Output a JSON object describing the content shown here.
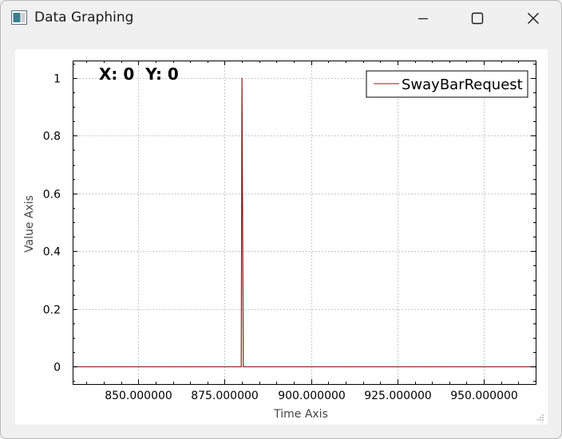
{
  "window": {
    "title": "Data Graphing",
    "icons": {
      "app": "chart-window-icon",
      "minimize": "minimize-icon",
      "maximize": "maximize-icon",
      "close": "close-icon",
      "grip": "resize-grip-icon"
    }
  },
  "readout": {
    "text": "X: 0  Y: 0"
  },
  "chart_data": {
    "type": "line",
    "xlabel": "Time Axis",
    "ylabel": "Value Axis",
    "xlim": [
      831,
      965
    ],
    "ylim": [
      -0.06,
      1.06
    ],
    "x_ticks": [
      850,
      875,
      900,
      925,
      950
    ],
    "x_tick_labels": [
      "850.000000",
      "875.000000",
      "900.000000",
      "925.000000",
      "950.000000"
    ],
    "y_ticks": [
      0,
      0.2,
      0.4,
      0.6,
      0.8,
      1
    ],
    "y_tick_labels": [
      "0",
      "0.2",
      "0.4",
      "0.6",
      "0.8",
      "1"
    ],
    "grid": true,
    "legend_position": "top-right",
    "series": [
      {
        "name": "SwayBarRequest",
        "color": "#8b1a1a",
        "x": [
          831,
          879.8,
          880,
          880.4,
          965
        ],
        "y": [
          0,
          0,
          1,
          0,
          0
        ]
      }
    ]
  }
}
